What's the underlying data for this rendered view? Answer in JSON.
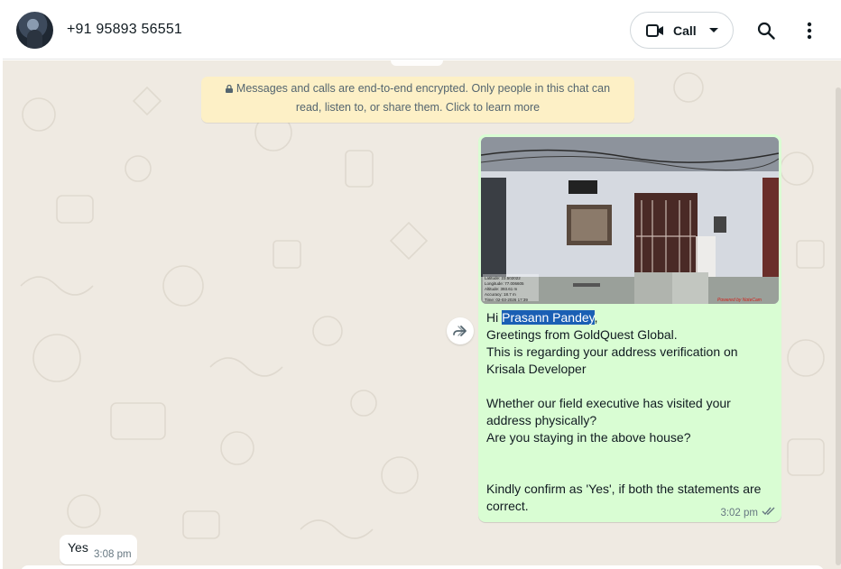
{
  "header": {
    "contact_name": "+91 95893 56551",
    "call_label": "Call",
    "icons": [
      "avatar",
      "video-camera-icon",
      "chevron-down-icon",
      "search-icon",
      "more-vert-icon"
    ]
  },
  "chat": {
    "encryption_notice": "Messages and calls are end-to-end encrypted. Only people in this chat can read, listen to, or share them. Click to learn more",
    "outgoing": {
      "greeting_prefix": "Hi ",
      "recipient_name": "Prasann Pandey",
      "greeting_suffix": ",",
      "body": "Greetings from GoldQuest Global.\nThis is regarding your address verification on Krisala Developer\n\nWhether our field executive has visited your address physically?\nAre you staying in the above house?\n\n\nKindly confirm as 'Yes', if both the statements are correct.",
      "time": "3:02 pm",
      "status": "delivered-double-tick",
      "photo_caption_lines": [
        "Latitude: 23.502022",
        "Longitude: 77.006605",
        "Altitude: 393.61 m",
        "Accuracy: 18.7 m",
        "Time: 02-03-2026 17:39"
      ],
      "photo_watermark": "Powered by NoteCam"
    },
    "incoming": {
      "text": "Yes",
      "time": "3:08 pm"
    }
  },
  "colors": {
    "outgoing_bubble": "#d9fdd3",
    "chat_background": "#efeae2",
    "encryption_bg": "#fdf0c6",
    "selection_highlight": "#1a5fb4"
  }
}
